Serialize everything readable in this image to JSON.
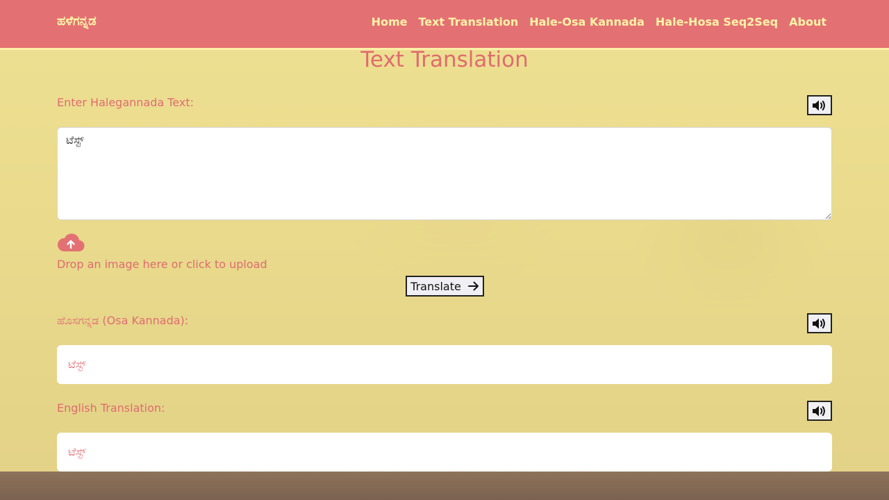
{
  "nav": {
    "brand": "ಹಳೆಗನ್ನಡ",
    "links": [
      "Home",
      "Text Translation",
      "Hale-Osa Kannada",
      "Hale-Hosa Seq2Seq",
      "About"
    ]
  },
  "page": {
    "title": "Text Translation"
  },
  "input": {
    "label": "Enter Halegannada Text:",
    "value": "ಟೆಸ್ಟ್"
  },
  "upload": {
    "text": "Drop an image here or click to upload",
    "icon": "cloud-upload-icon"
  },
  "translate": {
    "label": "Translate",
    "icon": "arrow-right-icon"
  },
  "osa": {
    "label": "ಹೊಸಗನ್ನಡ (Osa Kannada):",
    "value": "ಟೆಸ್ಟ್"
  },
  "english": {
    "label": "English Translation:",
    "value": "ಟೆಸ್ಟ್"
  },
  "colors": {
    "navbar": "#e37174",
    "nav_text": "#fff3a6",
    "accent_text": "#e06b70",
    "overlay": "#fcf096"
  }
}
